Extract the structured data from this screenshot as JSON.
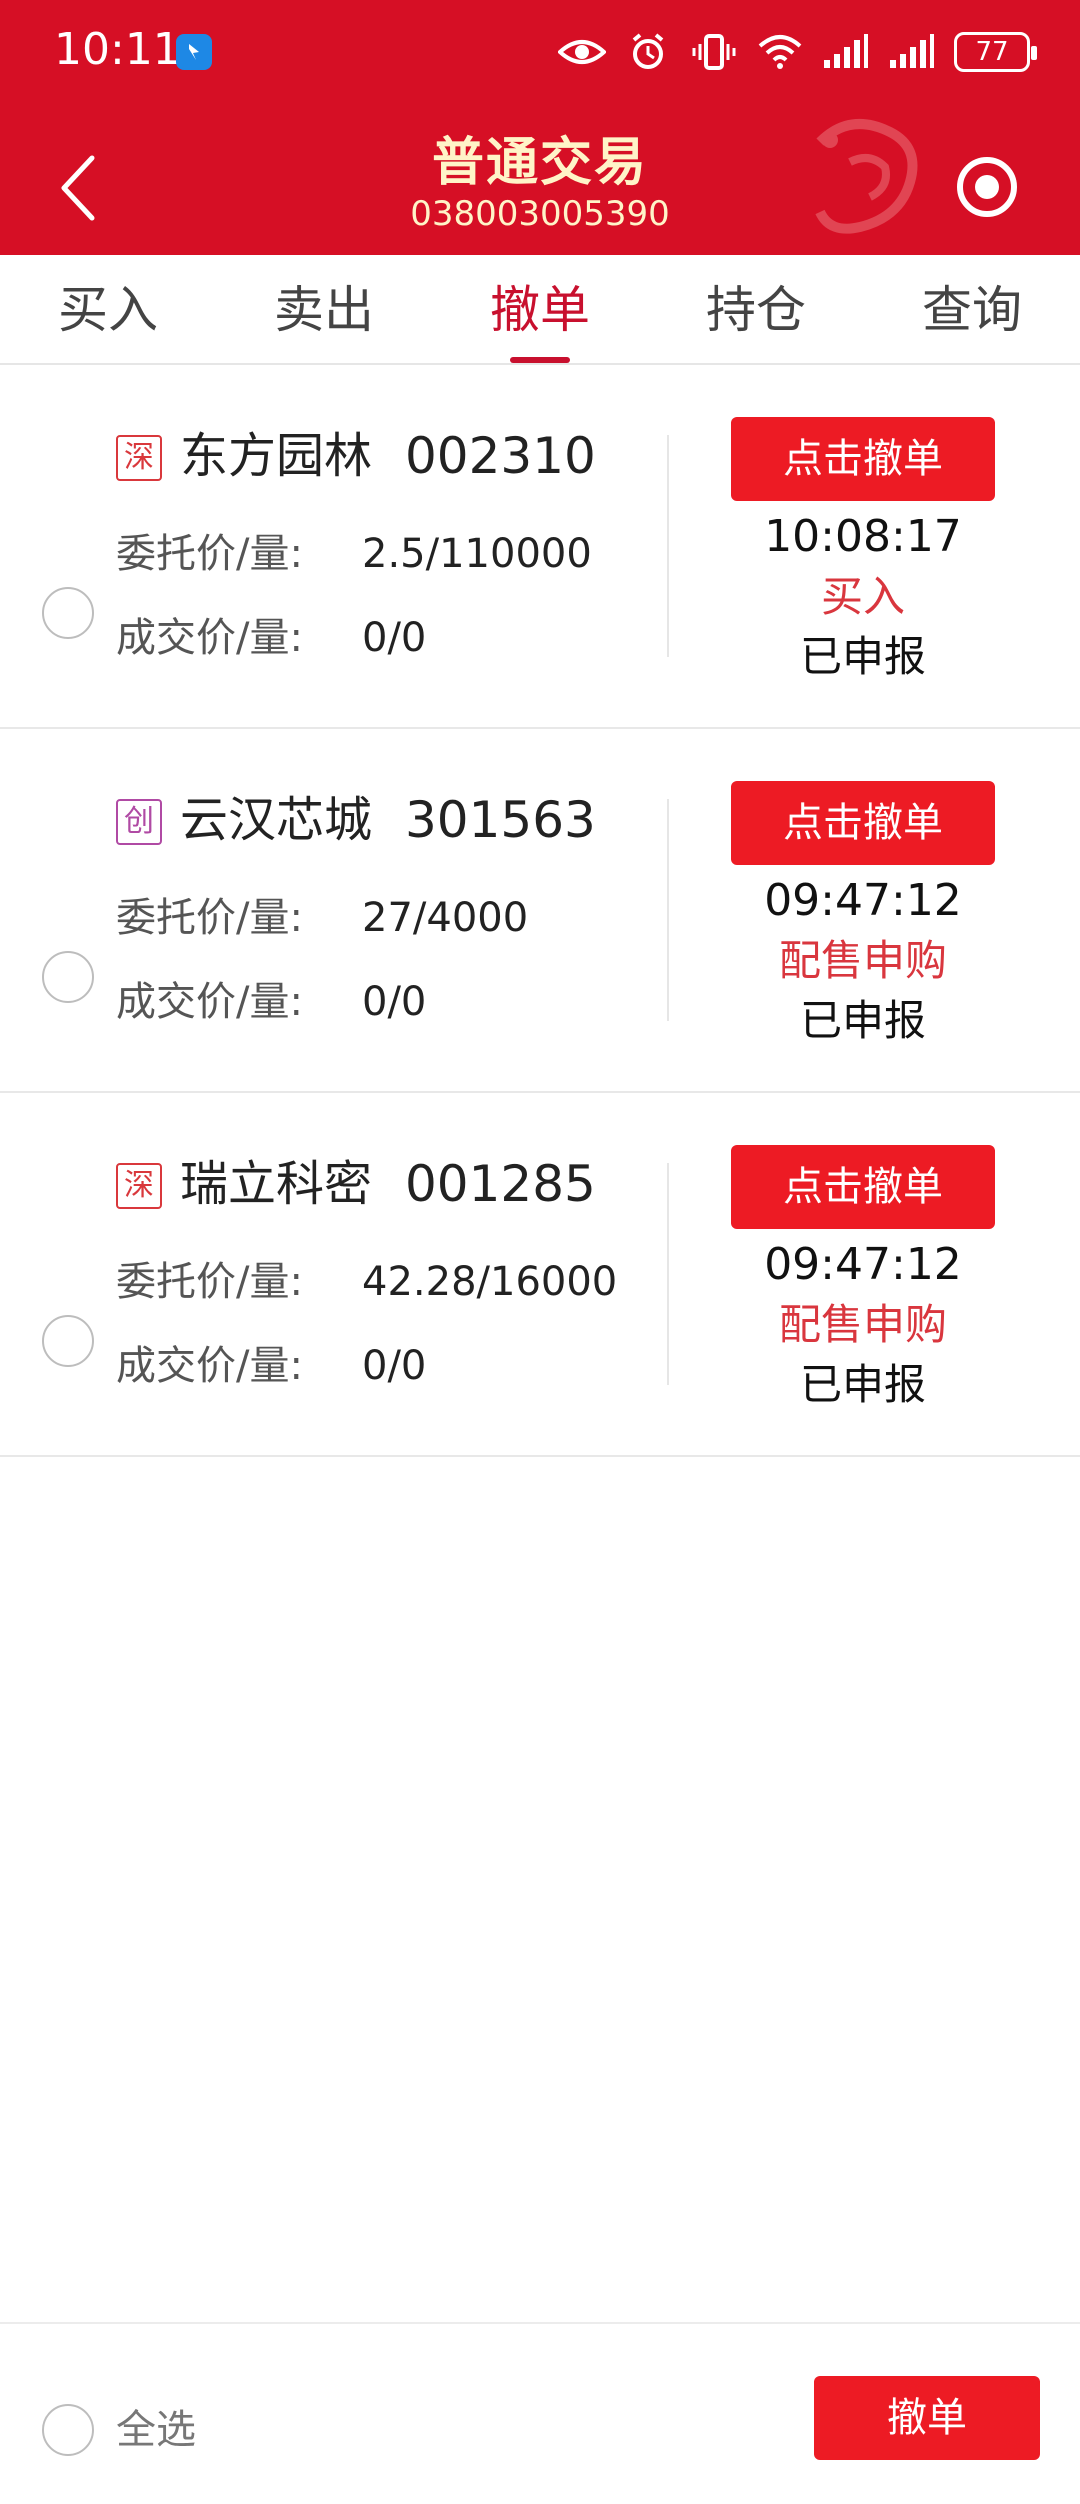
{
  "status_bar": {
    "time": "10:11",
    "battery": "77"
  },
  "header": {
    "title": "普通交易",
    "account": "038003005390"
  },
  "tabs": [
    {
      "label": "买入"
    },
    {
      "label": "卖出"
    },
    {
      "label": "撤单",
      "active": true
    },
    {
      "label": "持仓"
    },
    {
      "label": "查询"
    }
  ],
  "field_labels": {
    "order_price_qty": "委托价/量:",
    "deal_price_qty": "成交价/量:"
  },
  "orders": [
    {
      "market": "深",
      "name": "东方园林",
      "code": "002310",
      "order_price_qty": "2.5/110000",
      "deal_price_qty": "0/0",
      "cancel_label": "点击撤单",
      "time": "10:08:17",
      "type": "买入",
      "status": "已申报"
    },
    {
      "market": "创",
      "name": "云汉芯城",
      "code": "301563",
      "order_price_qty": "27/4000",
      "deal_price_qty": "0/0",
      "cancel_label": "点击撤单",
      "time": "09:47:12",
      "type": "配售申购",
      "status": "已申报"
    },
    {
      "market": "深",
      "name": "瑞立科密",
      "code": "001285",
      "order_price_qty": "42.28/16000",
      "deal_price_qty": "0/0",
      "cancel_label": "点击撤单",
      "time": "09:47:12",
      "type": "配售申购",
      "status": "已申报"
    }
  ],
  "bottom_bar": {
    "select_all": "全选",
    "cancel_button": "撤单"
  },
  "colors": {
    "brand_red": "#d60f25",
    "button_red": "#ed1b24",
    "title_cream": "#fff4c8",
    "type_red": "#d9363e"
  }
}
